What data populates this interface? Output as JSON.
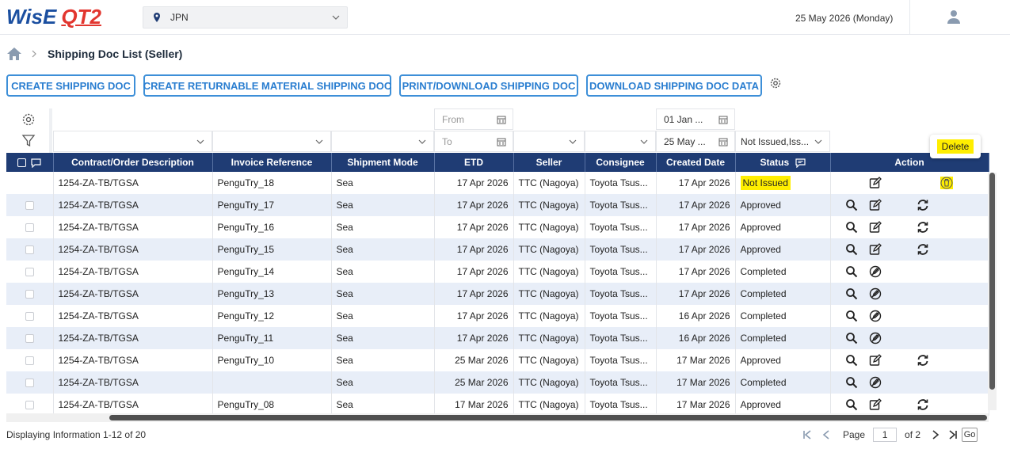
{
  "header": {
    "logo_main": "WisE",
    "logo_sub": "QT2",
    "region": "JPN",
    "date": "25 May 2026 (Monday)"
  },
  "breadcrumb": {
    "title": "Shipping Doc List (Seller)"
  },
  "toolbar": {
    "create_shipping_doc": "CREATE SHIPPING DOC",
    "create_returnable": "CREATE RETURNABLE MATERIAL SHIPPING DOC",
    "print_download": "PRINT/DOWNLOAD SHIPPING DOC",
    "download_data": "DOWNLOAD SHIPPING DOC DATA"
  },
  "filters": {
    "etd_from": "From",
    "etd_to": "To",
    "created_from": "01 Jan ...",
    "created_to": "25 May ...",
    "status": "Not Issued,Iss..."
  },
  "columns": {
    "contract": "Contract/Order Description",
    "invoice": "Invoice Reference",
    "shipment": "Shipment Mode",
    "etd": "ETD",
    "seller": "Seller",
    "consignee": "Consignee",
    "created": "Created Date",
    "status": "Status",
    "action": "Action"
  },
  "rows": [
    {
      "contract": "1254-ZA-TB/TGSA",
      "invoice": "PenguTry_18",
      "shipment": "Sea",
      "etd": "17 Apr 2026",
      "seller": "TTC (Nagoya)",
      "consignee": "Toyota Tsus...",
      "created": "17 Apr 2026",
      "status": "Not Issued",
      "actions": [
        "edit",
        "delete"
      ]
    },
    {
      "contract": "1254-ZA-TB/TGSA",
      "invoice": "PenguTry_17",
      "shipment": "Sea",
      "etd": "17 Apr 2026",
      "seller": "TTC (Nagoya)",
      "consignee": "Toyota Tsus...",
      "created": "17 Apr 2026",
      "status": "Approved",
      "actions": [
        "view",
        "edit",
        "refresh"
      ]
    },
    {
      "contract": "1254-ZA-TB/TGSA",
      "invoice": "PenguTry_16",
      "shipment": "Sea",
      "etd": "17 Apr 2026",
      "seller": "TTC (Nagoya)",
      "consignee": "Toyota Tsus...",
      "created": "17 Apr 2026",
      "status": "Approved",
      "actions": [
        "view",
        "edit",
        "refresh"
      ]
    },
    {
      "contract": "1254-ZA-TB/TGSA",
      "invoice": "PenguTry_15",
      "shipment": "Sea",
      "etd": "17 Apr 2026",
      "seller": "TTC (Nagoya)",
      "consignee": "Toyota Tsus...",
      "created": "17 Apr 2026",
      "status": "Approved",
      "actions": [
        "view",
        "edit",
        "refresh"
      ]
    },
    {
      "contract": "1254-ZA-TB/TGSA",
      "invoice": "PenguTry_14",
      "shipment": "Sea",
      "etd": "17 Apr 2026",
      "seller": "TTC (Nagoya)",
      "consignee": "Toyota Tsus...",
      "created": "17 Apr 2026",
      "status": "Completed",
      "actions": [
        "view",
        "noedit"
      ]
    },
    {
      "contract": "1254-ZA-TB/TGSA",
      "invoice": "PenguTry_13",
      "shipment": "Sea",
      "etd": "17 Apr 2026",
      "seller": "TTC (Nagoya)",
      "consignee": "Toyota Tsus...",
      "created": "17 Apr 2026",
      "status": "Completed",
      "actions": [
        "view",
        "noedit"
      ]
    },
    {
      "contract": "1254-ZA-TB/TGSA",
      "invoice": "PenguTry_12",
      "shipment": "Sea",
      "etd": "17 Apr 2026",
      "seller": "TTC (Nagoya)",
      "consignee": "Toyota Tsus...",
      "created": "16 Apr 2026",
      "status": "Completed",
      "actions": [
        "view",
        "noedit"
      ]
    },
    {
      "contract": "1254-ZA-TB/TGSA",
      "invoice": "PenguTry_11",
      "shipment": "Sea",
      "etd": "17 Apr 2026",
      "seller": "TTC (Nagoya)",
      "consignee": "Toyota Tsus...",
      "created": "16 Apr 2026",
      "status": "Completed",
      "actions": [
        "view",
        "noedit"
      ]
    },
    {
      "contract": "1254-ZA-TB/TGSA",
      "invoice": "PenguTry_10",
      "shipment": "Sea",
      "etd": "25 Mar 2026",
      "seller": "TTC (Nagoya)",
      "consignee": "Toyota Tsus...",
      "created": "17 Mar 2026",
      "status": "Approved",
      "actions": [
        "view",
        "edit",
        "refresh"
      ]
    },
    {
      "contract": "1254-ZA-TB/TGSA",
      "invoice": "",
      "shipment": "Sea",
      "etd": "25 Mar 2026",
      "seller": "TTC (Nagoya)",
      "consignee": "Toyota Tsus...",
      "created": "17 Mar 2026",
      "status": "Completed",
      "actions": [
        "view",
        "noedit"
      ]
    },
    {
      "contract": "1254-ZA-TB/TGSA",
      "invoice": "PenguTry_08",
      "shipment": "Sea",
      "etd": "17 Mar 2026",
      "seller": "TTC (Nagoya)",
      "consignee": "Toyota Tsus...",
      "created": "17 Mar 2026",
      "status": "Approved",
      "actions": [
        "view",
        "edit",
        "refresh"
      ]
    }
  ],
  "tooltip": "Delete",
  "footer": {
    "display_info": "Displaying Information 1-12 of 20",
    "page_label": "Page",
    "page_value": "1",
    "page_total": "of 2",
    "go": "Go"
  },
  "colors": {
    "header_bg": "#1f3c74",
    "accent": "#2a7ed0",
    "highlight": "#ffee00",
    "row_alt": "#e8eef8"
  }
}
